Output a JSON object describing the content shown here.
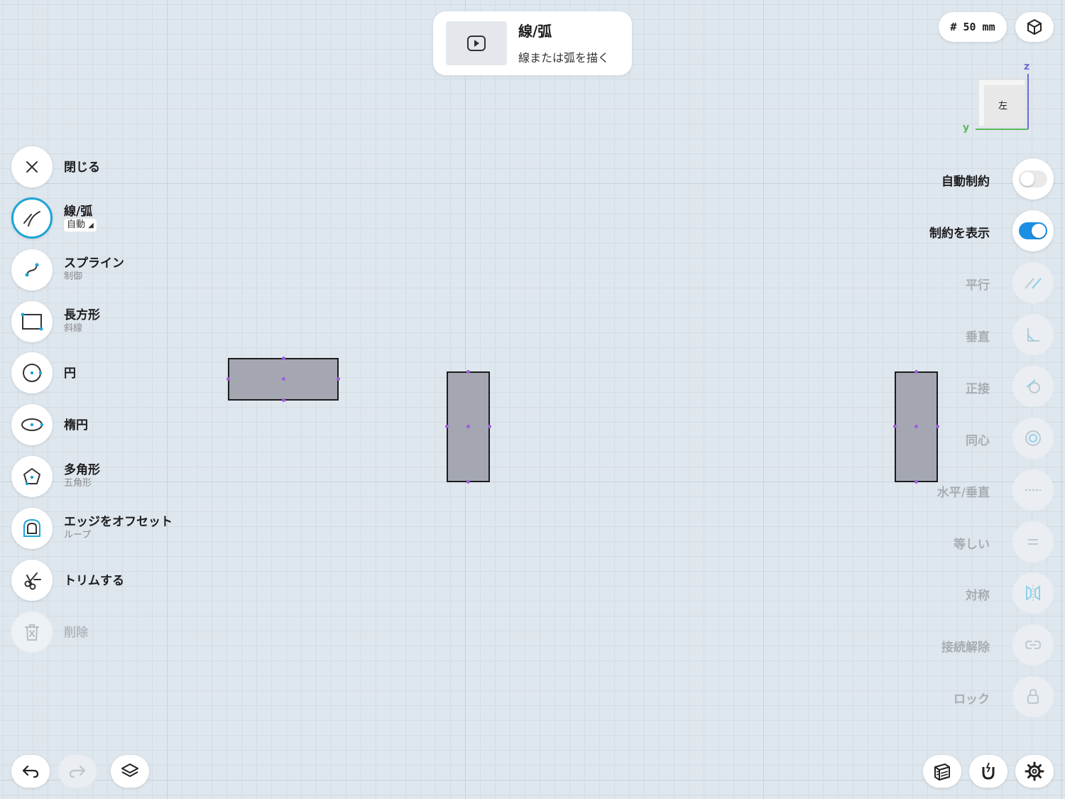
{
  "hint_card": {
    "title": "線/弧",
    "subtitle": "線または弧を描く",
    "video_icon": "play-icon"
  },
  "grid_size": {
    "label": "# 50 mm"
  },
  "view_cube": {
    "face_label": "左",
    "axis_z": "z",
    "axis_y": "y",
    "colors": {
      "z": "#6c6cd4",
      "y": "#5cb85c"
    }
  },
  "tools": [
    {
      "title": "閉じる",
      "sub": "",
      "icon": "close-icon"
    },
    {
      "title": "線/弧",
      "sub": "自動",
      "icon": "line-arc-icon",
      "active": true
    },
    {
      "title": "スプライン",
      "sub": "制御",
      "icon": "spline-icon"
    },
    {
      "title": "長方形",
      "sub": "斜線",
      "icon": "rectangle-icon"
    },
    {
      "title": "円",
      "sub": "",
      "icon": "circle-icon"
    },
    {
      "title": "楕円",
      "sub": "",
      "icon": "ellipse-icon"
    },
    {
      "title": "多角形",
      "sub": "五角形",
      "icon": "polygon-icon"
    },
    {
      "title": "エッジをオフセット",
      "sub": "ループ",
      "icon": "offset-edge-icon"
    },
    {
      "title": "トリムする",
      "sub": "",
      "icon": "scissors-icon"
    },
    {
      "title": "削除",
      "sub": "",
      "icon": "trash-icon",
      "disabled": true
    }
  ],
  "constraints": [
    {
      "label": "自動制約",
      "type": "toggle",
      "on": false
    },
    {
      "label": "制約を表示",
      "type": "toggle",
      "on": true
    },
    {
      "label": "平行",
      "icon": "parallel-icon"
    },
    {
      "label": "垂直",
      "icon": "perpendicular-icon"
    },
    {
      "label": "正接",
      "icon": "tangent-icon"
    },
    {
      "label": "同心",
      "icon": "concentric-icon"
    },
    {
      "label": "水平/垂直",
      "icon": "horizontal-vertical-icon"
    },
    {
      "label": "等しい",
      "icon": "equal-icon"
    },
    {
      "label": "対称",
      "icon": "symmetric-icon"
    },
    {
      "label": "接続解除",
      "icon": "disconnect-icon"
    },
    {
      "label": "ロック",
      "icon": "lock-icon"
    }
  ],
  "colors": {
    "accent": "#1ea4d6",
    "toggle_on": "#1a8fe3",
    "shape_fill": "#a4a7b2",
    "vertex": "#a05de0"
  }
}
